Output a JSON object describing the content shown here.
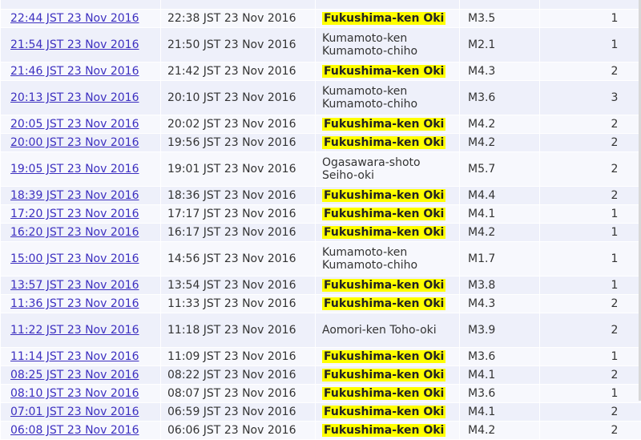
{
  "colors": {
    "link": "#3c2fc0",
    "highlight": "#ffff00",
    "row_alt_a": "#eef0fa",
    "row_alt_b": "#f7f8fd"
  },
  "rows": [
    {
      "dt": "22:44 JST 23 Nov 2016",
      "obs": "22:38 JST 23 Nov 2016",
      "region": "Fukushima-ken Oki",
      "mag": "M3.5",
      "intensity": "1",
      "highlight": true
    },
    {
      "dt": "21:54 JST 23 Nov 2016",
      "obs": "21:50 JST 23 Nov 2016",
      "region": "Kumamoto-ken Kumamoto-chiho",
      "mag": "M2.1",
      "intensity": "1",
      "highlight": false
    },
    {
      "dt": "21:46 JST 23 Nov 2016",
      "obs": "21:42 JST 23 Nov 2016",
      "region": "Fukushima-ken Oki",
      "mag": "M4.3",
      "intensity": "2",
      "highlight": true
    },
    {
      "dt": "20:13 JST 23 Nov 2016",
      "obs": "20:10 JST 23 Nov 2016",
      "region": "Kumamoto-ken Kumamoto-chiho",
      "mag": "M3.6",
      "intensity": "3",
      "highlight": false
    },
    {
      "dt": "20:05 JST 23 Nov 2016",
      "obs": "20:02 JST 23 Nov 2016",
      "region": "Fukushima-ken Oki",
      "mag": "M4.2",
      "intensity": "2",
      "highlight": true
    },
    {
      "dt": "20:00 JST 23 Nov 2016",
      "obs": "19:56 JST 23 Nov 2016",
      "region": "Fukushima-ken Oki",
      "mag": "M4.2",
      "intensity": "2",
      "highlight": true
    },
    {
      "dt": "19:05 JST 23 Nov 2016",
      "obs": "19:01 JST 23 Nov 2016",
      "region": "Ogasawara-shoto Seiho-oki",
      "mag": "M5.7",
      "intensity": "2",
      "highlight": false
    },
    {
      "dt": "18:39 JST 23 Nov 2016",
      "obs": "18:36 JST 23 Nov 2016",
      "region": "Fukushima-ken Oki",
      "mag": "M4.4",
      "intensity": "2",
      "highlight": true
    },
    {
      "dt": "17:20 JST 23 Nov 2016",
      "obs": "17:17 JST 23 Nov 2016",
      "region": "Fukushima-ken Oki",
      "mag": "M4.1",
      "intensity": "1",
      "highlight": true
    },
    {
      "dt": "16:20 JST 23 Nov 2016",
      "obs": "16:17 JST 23 Nov 2016",
      "region": "Fukushima-ken Oki",
      "mag": "M4.2",
      "intensity": "1",
      "highlight": true
    },
    {
      "dt": "15:00 JST 23 Nov 2016",
      "obs": "14:56 JST 23 Nov 2016",
      "region": "Kumamoto-ken Kumamoto-chiho",
      "mag": "M1.7",
      "intensity": "1",
      "highlight": false
    },
    {
      "dt": "13:57 JST 23 Nov 2016",
      "obs": "13:54 JST 23 Nov 2016",
      "region": "Fukushima-ken Oki",
      "mag": "M3.8",
      "intensity": "1",
      "highlight": true
    },
    {
      "dt": "11:36 JST 23 Nov 2016",
      "obs": "11:33 JST 23 Nov 2016",
      "region": "Fukushima-ken Oki",
      "mag": "M4.3",
      "intensity": "2",
      "highlight": true
    },
    {
      "dt": "11:22 JST 23 Nov 2016",
      "obs": "11:18 JST 23 Nov 2016",
      "region": "Aomori-ken Toho-oki",
      "mag": "M3.9",
      "intensity": "2",
      "highlight": false
    },
    {
      "dt": "11:14 JST 23 Nov 2016",
      "obs": "11:09 JST 23 Nov 2016",
      "region": "Fukushima-ken Oki",
      "mag": "M3.6",
      "intensity": "1",
      "highlight": true
    },
    {
      "dt": "08:25 JST 23 Nov 2016",
      "obs": "08:22 JST 23 Nov 2016",
      "region": "Fukushima-ken Oki",
      "mag": "M4.1",
      "intensity": "2",
      "highlight": true
    },
    {
      "dt": "08:10 JST 23 Nov 2016",
      "obs": "08:07 JST 23 Nov 2016",
      "region": "Fukushima-ken Oki",
      "mag": "M3.6",
      "intensity": "1",
      "highlight": true
    },
    {
      "dt": "07:01 JST 23 Nov 2016",
      "obs": "06:59 JST 23 Nov 2016",
      "region": "Fukushima-ken Oki",
      "mag": "M4.1",
      "intensity": "2",
      "highlight": true
    },
    {
      "dt": "06:08 JST 23 Nov 2016",
      "obs": "06:06 JST 23 Nov 2016",
      "region": "Fukushima-ken Oki",
      "mag": "M4.2",
      "intensity": "2",
      "highlight": true
    }
  ]
}
